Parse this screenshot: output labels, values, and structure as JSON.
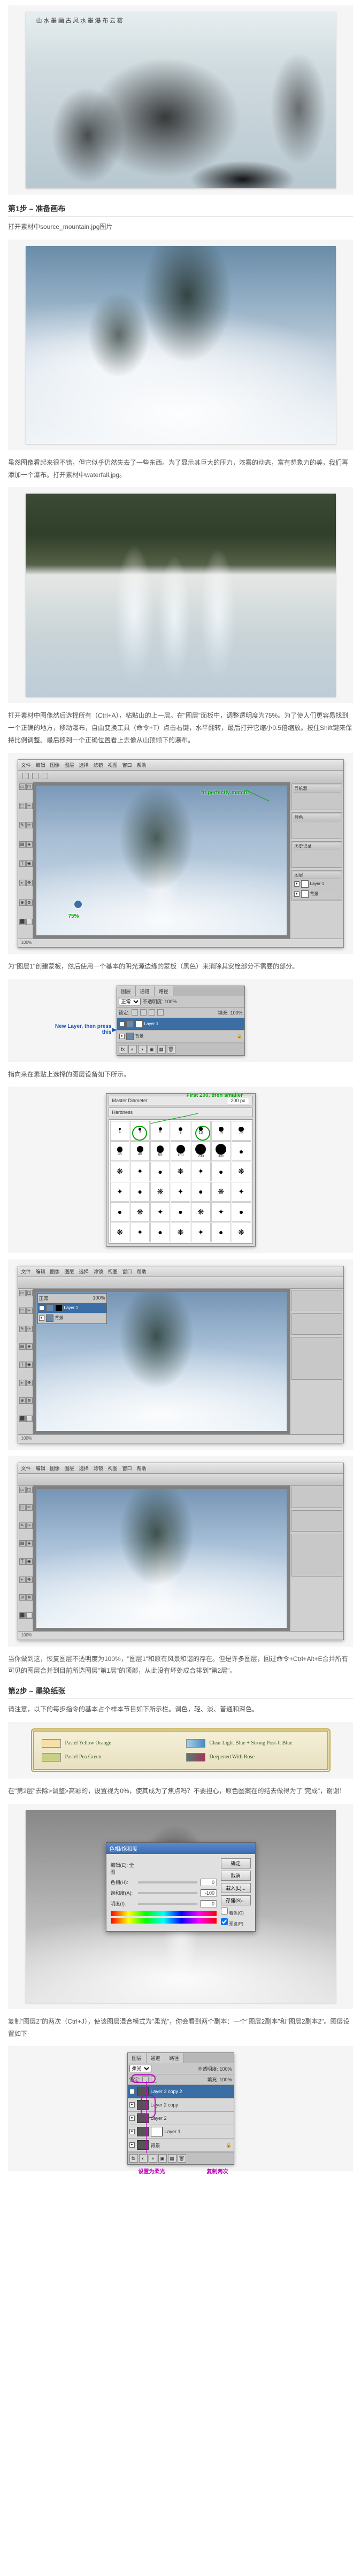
{
  "hero_calligraphy": "山 水 墨 画\n古 风 水 墨\n瀑 布 云 雾",
  "step1": {
    "title": "第1步 – 准备画布",
    "intro": "打开素材中source_mountain.jpg图片",
    "para_after_mtn": "虽然图像看起来很不错，但它似乎仍然失去了一些东西。为了显示其巨大的压力，浓雾的动态，富有想象力的美，我们再添加一个瀑布。打开素材中waterfall.jpg。",
    "para_after_wf": "打开素材中图像然后选择所有（Ctrl+A），粘贴山的上一层。在\"图层\"面板中，调整透明度为75%。为了使人们更容易找到一个正确的地方，移动瀑布，自由变换工具（命令+T）点击右键，水平翻转，最后打开它缩小0.5倍缩放。按住Shift键来保持比例调整。最后移到一个正确位置看上去像从山顶倾下的瀑布。",
    "anno_perfect": "fit perfectly match!",
    "anno_75": "75%",
    "para_after_blend": "为\"图层1\"创建蒙板，然后使用一个基本的阴光源边缘的蒙板（黑色）来消除其安栓部分不需要的部分。",
    "layers_panel": {
      "tabs": [
        "图层",
        "通道",
        "路径"
      ],
      "mode": "正常",
      "opacity": "不透明度: 100%",
      "lock": "锁定:",
      "fill": "填充: 100%",
      "layers": [
        {
          "name": "Layer 1",
          "bg_color": "#fff",
          "selected": true
        },
        {
          "name": "背景",
          "bg_color": "#fff",
          "selected": false
        }
      ],
      "anno_new": "New Layer, then press this",
      "anno_arrow_target": "蒙版按钮"
    },
    "para_after_layers": "指向来在素贴上选择的图层设备如下所示。",
    "brush_panel": {
      "title": "Master Diameter",
      "value": "200 px",
      "anno": "First 200, then smaller",
      "brush_sizes": [
        1,
        3,
        5,
        9,
        13,
        19,
        25,
        35,
        45,
        65,
        100,
        200,
        300,
        "",
        "",
        "",
        "",
        "",
        "",
        "",
        "",
        "",
        "",
        "",
        "",
        "",
        "",
        "",
        "",
        "",
        "",
        "",
        "",
        "",
        "",
        "",
        "",
        "",
        "",
        "",
        "",
        ""
      ]
    },
    "para_final": "当你做到这，恢复图层不透明度为100%，\"图层1\"和原有风景和谐的存在。但是许多图层，回过命令+Ctrl+Alt+E合并所有可见的图层合并到目前所选图层\"第1层\"的顶部，从此没有坏处成合排到\"第2层\"。"
  },
  "step2": {
    "title": "第2步 – 墨染纸张",
    "intro": "请注意，以下的每步指令的基本占个样本节目如下所示栏。调色，轻、淡、普通和深色。",
    "swatches": {
      "left": [
        {
          "label": "Pastel Yellow Orange",
          "color": "#f5e0a8"
        },
        {
          "label": "Pastel Pea Green",
          "color": "#c8d088"
        }
      ],
      "right": [
        {
          "label": "Clear Light Blue + Strong Post-It Blue",
          "start": "#a8d0e8",
          "end": "#4888c0"
        },
        {
          "label": "Deepened With Rose",
          "start": "#5a7a70",
          "end": "#a03858"
        }
      ]
    },
    "para_huesat": "在\"第2层\"去除>调整>高彩的，设置视为0%，使其成为了焦点吗？不要担心，原色图案在的结去做得为了\"完成\"，谢谢！",
    "hue_sat_dialog": {
      "title": "色相/饱和度",
      "edit": "编辑(E): 全图",
      "hue": "色相(H):",
      "sat": "饱和度(A):",
      "sat_val": "-100",
      "light": "明度(I):",
      "ok": "确定",
      "cancel": "取消",
      "load": "载入(L)...",
      "save": "存储(S)...",
      "colorize": "着色(O)",
      "preview": "预览(P)"
    },
    "para_dup": "复制\"图层2\"的两次（Ctrl+J），使该图层混合模式为\"柔光\"，你会看到两个副本：一个\"图层2副本\"和\"图层2副本2\"。图层设置如下",
    "stack_panel": {
      "tabs": [
        "图层",
        "通道",
        "路径"
      ],
      "mode": "柔光",
      "opacity": "不透明度: 100%",
      "lock": "锁定:",
      "fill": "填充: 100%",
      "layers": [
        {
          "name": "Layer 2 copy 2",
          "selected": true
        },
        {
          "name": "Layer 2 copy",
          "selected": false
        },
        {
          "name": "Layer 2",
          "selected": false
        },
        {
          "name": "Layer 1",
          "selected": false
        },
        {
          "name": "背景",
          "selected": false
        }
      ],
      "anno_mode": "设置为柔光",
      "anno_dup": "复制两次"
    }
  },
  "ps_menu": [
    "文件",
    "编辑",
    "图像",
    "图层",
    "选择",
    "滤镜",
    "视图",
    "窗口",
    "帮助"
  ],
  "ps_status": "100%"
}
